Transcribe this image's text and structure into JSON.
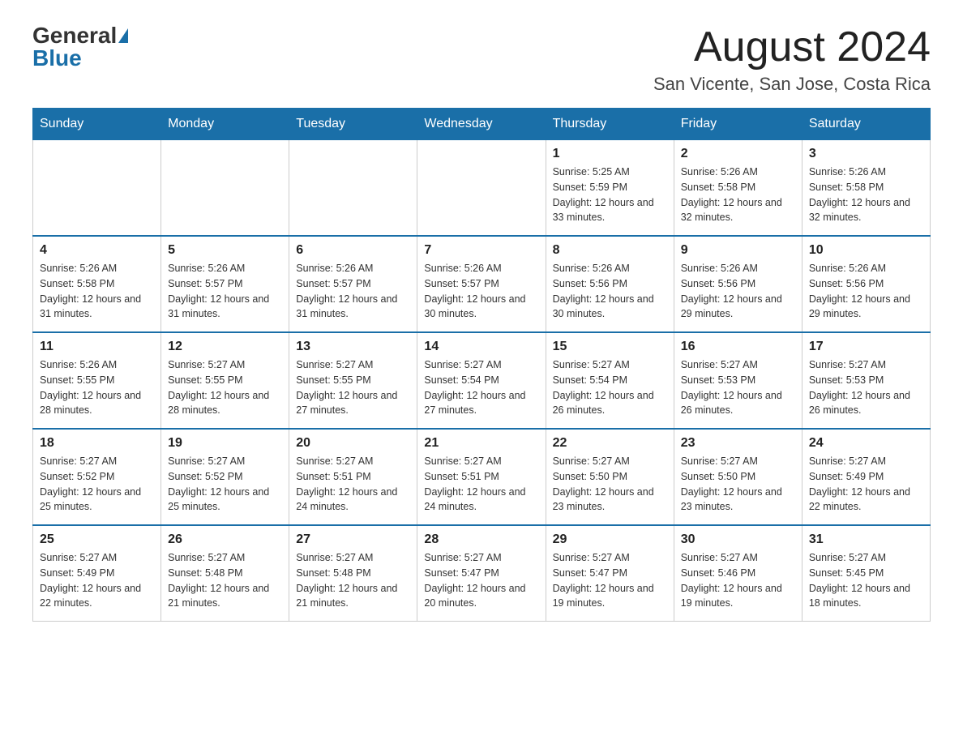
{
  "header": {
    "logo_general": "General",
    "logo_blue": "Blue",
    "month_year": "August 2024",
    "location": "San Vicente, San Jose, Costa Rica"
  },
  "weekdays": [
    "Sunday",
    "Monday",
    "Tuesday",
    "Wednesday",
    "Thursday",
    "Friday",
    "Saturday"
  ],
  "weeks": [
    [
      {
        "day": "",
        "info": ""
      },
      {
        "day": "",
        "info": ""
      },
      {
        "day": "",
        "info": ""
      },
      {
        "day": "",
        "info": ""
      },
      {
        "day": "1",
        "info": "Sunrise: 5:25 AM\nSunset: 5:59 PM\nDaylight: 12 hours and 33 minutes."
      },
      {
        "day": "2",
        "info": "Sunrise: 5:26 AM\nSunset: 5:58 PM\nDaylight: 12 hours and 32 minutes."
      },
      {
        "day": "3",
        "info": "Sunrise: 5:26 AM\nSunset: 5:58 PM\nDaylight: 12 hours and 32 minutes."
      }
    ],
    [
      {
        "day": "4",
        "info": "Sunrise: 5:26 AM\nSunset: 5:58 PM\nDaylight: 12 hours and 31 minutes."
      },
      {
        "day": "5",
        "info": "Sunrise: 5:26 AM\nSunset: 5:57 PM\nDaylight: 12 hours and 31 minutes."
      },
      {
        "day": "6",
        "info": "Sunrise: 5:26 AM\nSunset: 5:57 PM\nDaylight: 12 hours and 31 minutes."
      },
      {
        "day": "7",
        "info": "Sunrise: 5:26 AM\nSunset: 5:57 PM\nDaylight: 12 hours and 30 minutes."
      },
      {
        "day": "8",
        "info": "Sunrise: 5:26 AM\nSunset: 5:56 PM\nDaylight: 12 hours and 30 minutes."
      },
      {
        "day": "9",
        "info": "Sunrise: 5:26 AM\nSunset: 5:56 PM\nDaylight: 12 hours and 29 minutes."
      },
      {
        "day": "10",
        "info": "Sunrise: 5:26 AM\nSunset: 5:56 PM\nDaylight: 12 hours and 29 minutes."
      }
    ],
    [
      {
        "day": "11",
        "info": "Sunrise: 5:26 AM\nSunset: 5:55 PM\nDaylight: 12 hours and 28 minutes."
      },
      {
        "day": "12",
        "info": "Sunrise: 5:27 AM\nSunset: 5:55 PM\nDaylight: 12 hours and 28 minutes."
      },
      {
        "day": "13",
        "info": "Sunrise: 5:27 AM\nSunset: 5:55 PM\nDaylight: 12 hours and 27 minutes."
      },
      {
        "day": "14",
        "info": "Sunrise: 5:27 AM\nSunset: 5:54 PM\nDaylight: 12 hours and 27 minutes."
      },
      {
        "day": "15",
        "info": "Sunrise: 5:27 AM\nSunset: 5:54 PM\nDaylight: 12 hours and 26 minutes."
      },
      {
        "day": "16",
        "info": "Sunrise: 5:27 AM\nSunset: 5:53 PM\nDaylight: 12 hours and 26 minutes."
      },
      {
        "day": "17",
        "info": "Sunrise: 5:27 AM\nSunset: 5:53 PM\nDaylight: 12 hours and 26 minutes."
      }
    ],
    [
      {
        "day": "18",
        "info": "Sunrise: 5:27 AM\nSunset: 5:52 PM\nDaylight: 12 hours and 25 minutes."
      },
      {
        "day": "19",
        "info": "Sunrise: 5:27 AM\nSunset: 5:52 PM\nDaylight: 12 hours and 25 minutes."
      },
      {
        "day": "20",
        "info": "Sunrise: 5:27 AM\nSunset: 5:51 PM\nDaylight: 12 hours and 24 minutes."
      },
      {
        "day": "21",
        "info": "Sunrise: 5:27 AM\nSunset: 5:51 PM\nDaylight: 12 hours and 24 minutes."
      },
      {
        "day": "22",
        "info": "Sunrise: 5:27 AM\nSunset: 5:50 PM\nDaylight: 12 hours and 23 minutes."
      },
      {
        "day": "23",
        "info": "Sunrise: 5:27 AM\nSunset: 5:50 PM\nDaylight: 12 hours and 23 minutes."
      },
      {
        "day": "24",
        "info": "Sunrise: 5:27 AM\nSunset: 5:49 PM\nDaylight: 12 hours and 22 minutes."
      }
    ],
    [
      {
        "day": "25",
        "info": "Sunrise: 5:27 AM\nSunset: 5:49 PM\nDaylight: 12 hours and 22 minutes."
      },
      {
        "day": "26",
        "info": "Sunrise: 5:27 AM\nSunset: 5:48 PM\nDaylight: 12 hours and 21 minutes."
      },
      {
        "day": "27",
        "info": "Sunrise: 5:27 AM\nSunset: 5:48 PM\nDaylight: 12 hours and 21 minutes."
      },
      {
        "day": "28",
        "info": "Sunrise: 5:27 AM\nSunset: 5:47 PM\nDaylight: 12 hours and 20 minutes."
      },
      {
        "day": "29",
        "info": "Sunrise: 5:27 AM\nSunset: 5:47 PM\nDaylight: 12 hours and 19 minutes."
      },
      {
        "day": "30",
        "info": "Sunrise: 5:27 AM\nSunset: 5:46 PM\nDaylight: 12 hours and 19 minutes."
      },
      {
        "day": "31",
        "info": "Sunrise: 5:27 AM\nSunset: 5:45 PM\nDaylight: 12 hours and 18 minutes."
      }
    ]
  ]
}
